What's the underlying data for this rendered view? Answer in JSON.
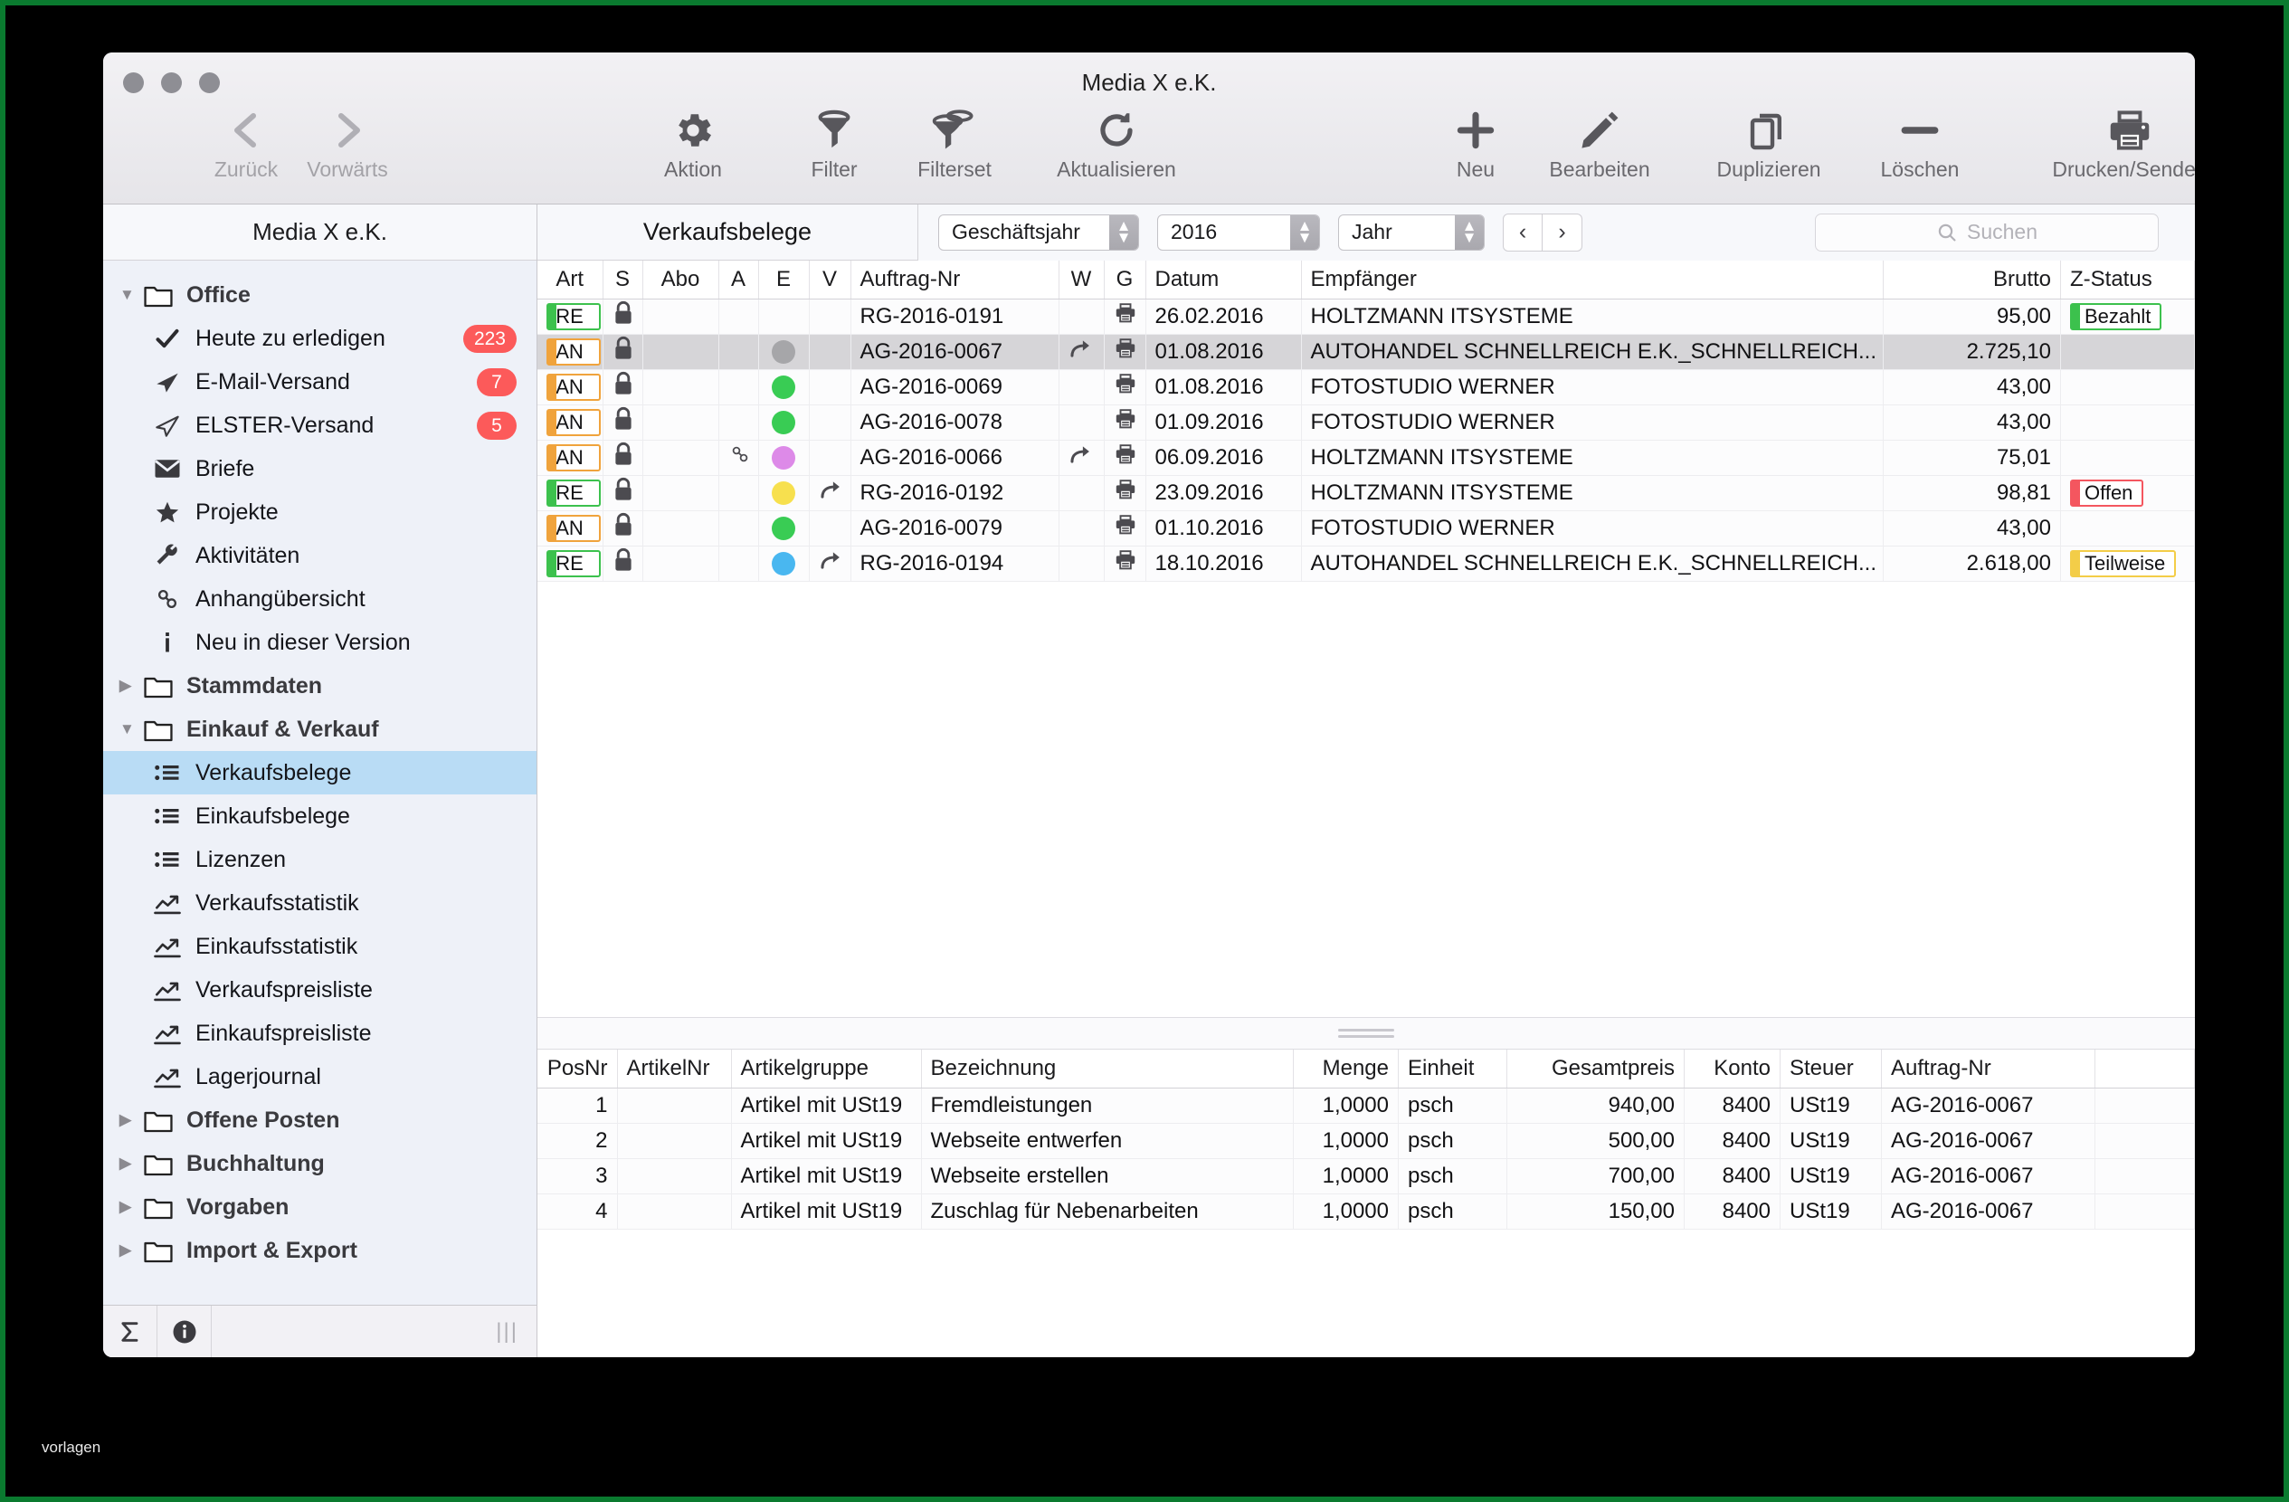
{
  "window": {
    "title": "Media X e.K."
  },
  "toolbar": {
    "back": "Zurück",
    "forward": "Vorwärts",
    "aktion": "Aktion",
    "filter": "Filter",
    "filterset": "Filterset",
    "aktualisieren": "Aktualisieren",
    "neu": "Neu",
    "bearbeiten": "Bearbeiten",
    "duplizieren": "Duplizieren",
    "loeschen": "Löschen",
    "drucken": "Drucken/Senden"
  },
  "sidebar": {
    "header": "Media X e.K.",
    "items": [
      {
        "label": "Office",
        "type": "group",
        "state": "open",
        "icon": "folder-icon"
      },
      {
        "label": "Heute zu erledigen",
        "type": "leaf",
        "icon": "check-icon",
        "badge": "223"
      },
      {
        "label": "E-Mail-Versand",
        "type": "leaf",
        "icon": "send-icon",
        "badge": "7"
      },
      {
        "label": "ELSTER-Versand",
        "type": "leaf",
        "icon": "send-outline-icon",
        "badge": "5"
      },
      {
        "label": "Briefe",
        "type": "leaf",
        "icon": "envelope-icon"
      },
      {
        "label": "Projekte",
        "type": "leaf",
        "icon": "star-icon"
      },
      {
        "label": "Aktivitäten",
        "type": "leaf",
        "icon": "wrench-icon"
      },
      {
        "label": "Anhangübersicht",
        "type": "leaf",
        "icon": "link-icon"
      },
      {
        "label": "Neu in dieser Version",
        "type": "leaf",
        "icon": "info-icon"
      },
      {
        "label": "Stammdaten",
        "type": "group",
        "state": "closed",
        "icon": "folder-icon"
      },
      {
        "label": "Einkauf & Verkauf",
        "type": "group",
        "state": "open",
        "icon": "folder-icon"
      },
      {
        "label": "Verkaufsbelege",
        "type": "leaf",
        "icon": "list-icon",
        "selected": true
      },
      {
        "label": "Einkaufsbelege",
        "type": "leaf",
        "icon": "list-icon"
      },
      {
        "label": "Lizenzen",
        "type": "leaf",
        "icon": "list-icon"
      },
      {
        "label": "Verkaufsstatistik",
        "type": "leaf",
        "icon": "chart-icon"
      },
      {
        "label": "Einkaufsstatistik",
        "type": "leaf",
        "icon": "chart-icon"
      },
      {
        "label": "Verkaufspreisliste",
        "type": "leaf",
        "icon": "chart-icon"
      },
      {
        "label": "Einkaufspreisliste",
        "type": "leaf",
        "icon": "chart-icon"
      },
      {
        "label": "Lagerjournal",
        "type": "leaf",
        "icon": "chart-icon"
      },
      {
        "label": "Offene Posten",
        "type": "group",
        "state": "closed",
        "icon": "folder-icon"
      },
      {
        "label": "Buchhaltung",
        "type": "group",
        "state": "closed",
        "icon": "folder-icon"
      },
      {
        "label": "Vorgaben",
        "type": "group",
        "state": "closed",
        "icon": "folder-icon"
      },
      {
        "label": "Import & Export",
        "type": "group",
        "state": "closed",
        "icon": "folder-icon"
      }
    ],
    "footer": {
      "sum_icon": "sigma-icon",
      "info_icon": "info-circle-icon",
      "grip": "|||"
    }
  },
  "filterbar": {
    "page_title": "Verkaufsbelege",
    "period_type": "Geschäftsjahr",
    "year": "2016",
    "granularity": "Jahr",
    "prev": "‹",
    "next": "›",
    "search_placeholder": "Suchen",
    "search_value": ""
  },
  "documents_table": {
    "columns": [
      "Art",
      "S",
      "Abo",
      "A",
      "E",
      "V",
      "Auftrag-Nr",
      "W",
      "G",
      "Datum",
      "Empfänger",
      "Brutto",
      "Z-Status"
    ],
    "rows": [
      {
        "art": "RE",
        "art_color": "#3cc14d",
        "lock": true,
        "abo": "",
        "a": "",
        "e": "",
        "v": "",
        "nr": "RG-2016-0191",
        "w": "",
        "g": "print",
        "datum": "26.02.2016",
        "empf": "HOLTZMANN ITSYSTEME",
        "brutto": "95,00",
        "z": "Bezahlt",
        "z_kind": "ok",
        "selected": false
      },
      {
        "art": "AN",
        "art_color": "#f0a33c",
        "lock": true,
        "abo": "",
        "a": "",
        "e": "#a6a6a9",
        "v": "",
        "nr": "AG-2016-0067",
        "w": "fwd",
        "g": "print",
        "datum": "01.08.2016",
        "empf": "AUTOHANDEL SCHNELLREICH E.K._SCHNELLREICH...",
        "brutto": "2.725,10",
        "z": "",
        "z_kind": "",
        "selected": true
      },
      {
        "art": "AN",
        "art_color": "#f0a33c",
        "lock": true,
        "abo": "",
        "a": "",
        "e": "#39cc54",
        "v": "",
        "nr": "AG-2016-0069",
        "w": "",
        "g": "print",
        "datum": "01.08.2016",
        "empf": "FOTOSTUDIO WERNER",
        "brutto": "43,00",
        "z": "",
        "z_kind": "",
        "selected": false
      },
      {
        "art": "AN",
        "art_color": "#f0a33c",
        "lock": true,
        "abo": "",
        "a": "",
        "e": "#39cc54",
        "v": "",
        "nr": "AG-2016-0078",
        "w": "",
        "g": "print",
        "datum": "01.09.2016",
        "empf": "FOTOSTUDIO WERNER",
        "brutto": "43,00",
        "z": "",
        "z_kind": "",
        "selected": false
      },
      {
        "art": "AN",
        "art_color": "#f0a33c",
        "lock": true,
        "abo": "",
        "a": "link",
        "e": "#dd8ae8",
        "v": "",
        "nr": "AG-2016-0066",
        "w": "fwd",
        "g": "print",
        "datum": "06.09.2016",
        "empf": "HOLTZMANN ITSYSTEME",
        "brutto": "75,01",
        "z": "",
        "z_kind": "",
        "selected": false
      },
      {
        "art": "RE",
        "art_color": "#3cc14d",
        "lock": true,
        "abo": "",
        "a": "",
        "e": "#f7e04e",
        "v": "fwd",
        "nr": "RG-2016-0192",
        "w": "",
        "g": "print",
        "datum": "23.09.2016",
        "empf": "HOLTZMANN ITSYSTEME",
        "brutto": "98,81",
        "z": "Offen",
        "z_kind": "open",
        "selected": false
      },
      {
        "art": "AN",
        "art_color": "#f0a33c",
        "lock": true,
        "abo": "",
        "a": "",
        "e": "#39cc54",
        "v": "",
        "nr": "AG-2016-0079",
        "w": "",
        "g": "print",
        "datum": "01.10.2016",
        "empf": "FOTOSTUDIO WERNER",
        "brutto": "43,00",
        "z": "",
        "z_kind": "",
        "selected": false
      },
      {
        "art": "RE",
        "art_color": "#3cc14d",
        "lock": true,
        "abo": "",
        "a": "",
        "e": "#49b7f0",
        "v": "fwd",
        "nr": "RG-2016-0194",
        "w": "",
        "g": "print",
        "datum": "18.10.2016",
        "empf": "AUTOHANDEL SCHNELLREICH E.K._SCHNELLREICH...",
        "brutto": "2.618,00",
        "z": "Teilweise",
        "z_kind": "part",
        "selected": false
      }
    ]
  },
  "positions_table": {
    "columns": [
      "PosNr",
      "ArtikelNr",
      "Artikelgruppe",
      "Bezeichnung",
      "Menge",
      "Einheit",
      "Gesamtpreis",
      "Konto",
      "Steuer",
      "Auftrag-Nr"
    ],
    "rows": [
      {
        "pos": "1",
        "artnr": "",
        "gruppe": "Artikel mit USt19",
        "bez": "Fremdleistungen",
        "menge": "1,0000",
        "einheit": "psch",
        "preis": "940,00",
        "konto": "8400",
        "steuer": "USt19",
        "auftrag": "AG-2016-0067"
      },
      {
        "pos": "2",
        "artnr": "",
        "gruppe": "Artikel mit USt19",
        "bez": "Webseite entwerfen",
        "menge": "1,0000",
        "einheit": "psch",
        "preis": "500,00",
        "konto": "8400",
        "steuer": "USt19",
        "auftrag": "AG-2016-0067"
      },
      {
        "pos": "3",
        "artnr": "",
        "gruppe": "Artikel mit USt19",
        "bez": "Webseite erstellen",
        "menge": "1,0000",
        "einheit": "psch",
        "preis": "700,00",
        "konto": "8400",
        "steuer": "USt19",
        "auftrag": "AG-2016-0067"
      },
      {
        "pos": "4",
        "artnr": "",
        "gruppe": "Artikel mit USt19",
        "bez": "Zuschlag für Nebenarbeiten",
        "menge": "1,0000",
        "einheit": "psch",
        "preis": "150,00",
        "konto": "8400",
        "steuer": "USt19",
        "auftrag": "AG-2016-0067"
      }
    ]
  },
  "watermark": {
    "text": "vorlagen"
  },
  "colors": {
    "accent_selected_row": "#d6d5d8",
    "sidebar_selected": "#b9dcf5",
    "badge_red": "#fc5a5a",
    "status_green": "#3cc14d",
    "status_red": "#f4565f",
    "status_yellow": "#f3cd48",
    "type_orange": "#f0a33c"
  }
}
